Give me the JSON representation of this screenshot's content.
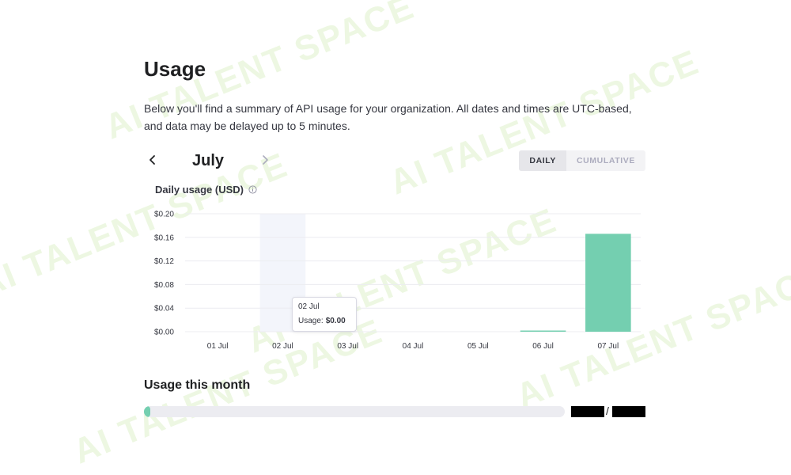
{
  "page": {
    "title": "Usage",
    "summary": "Below you'll find a summary of API usage for your organization. All dates and times are UTC-based, and data may be delayed up to 5 minutes."
  },
  "month_nav": {
    "label": "July"
  },
  "view_toggle": {
    "daily": "DAILY",
    "cumulative": "CUMULATIVE",
    "selected": "DAILY"
  },
  "chart_title": "Daily usage (USD)",
  "chart_data": {
    "type": "bar",
    "categories": [
      "01 Jul",
      "02 Jul",
      "03 Jul",
      "04 Jul",
      "05 Jul",
      "06 Jul",
      "07 Jul"
    ],
    "values": [
      0,
      0,
      0,
      0,
      0,
      0.002,
      0.166
    ],
    "yticks": [
      "$0.00",
      "$0.04",
      "$0.08",
      "$0.12",
      "$0.16",
      "$0.20"
    ],
    "ylim": [
      0,
      0.2
    ],
    "grid": true,
    "highlight_index": 1,
    "bar_color": "#74cfb0",
    "highlight_color": "#f3f5fb"
  },
  "tooltip": {
    "date": "02 Jul",
    "label": "Usage:",
    "value": "$0.00"
  },
  "usage_month": {
    "title": "Usage this month",
    "separator": "/",
    "progress_fraction": 0.015
  },
  "watermark": {
    "text": "AI TALENT SPACE"
  }
}
